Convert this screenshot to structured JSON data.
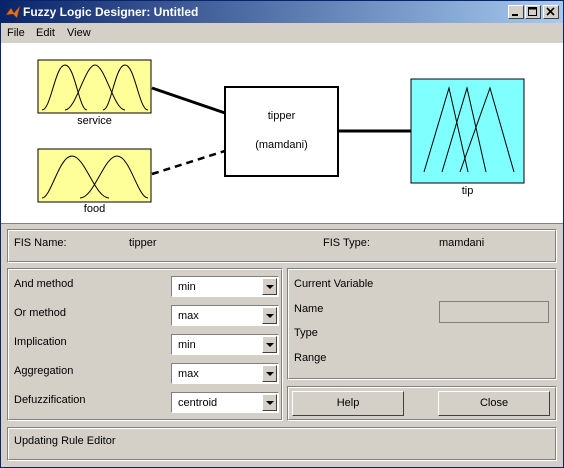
{
  "window": {
    "title": "Fuzzy Logic Designer: Untitled"
  },
  "menu": [
    "File",
    "Edit",
    "View"
  ],
  "diagram": {
    "inputs": [
      {
        "label": "service"
      },
      {
        "label": "food"
      }
    ],
    "system": {
      "name": "tipper",
      "type": "(mamdani)"
    },
    "output": {
      "label": "tip"
    },
    "colors": {
      "input_box": "#ffff99",
      "output_box": "#80ffff",
      "system_box": "#ffffff"
    }
  },
  "fis": {
    "name_label": "FIS Name:",
    "name_value": "tipper",
    "type_label": "FIS Type:",
    "type_value": "mamdani"
  },
  "methods": [
    {
      "label": "And method",
      "value": "min"
    },
    {
      "label": "Or method",
      "value": "max"
    },
    {
      "label": "Implication",
      "value": "min"
    },
    {
      "label": "Aggregation",
      "value": "max"
    },
    {
      "label": "Defuzzification",
      "value": "centroid"
    }
  ],
  "current_variable": {
    "title": "Current Variable",
    "name_label": "Name",
    "type_label": "Type",
    "range_label": "Range",
    "name_value": ""
  },
  "buttons": {
    "help": "Help",
    "close": "Close"
  },
  "status": "Updating Rule Editor"
}
